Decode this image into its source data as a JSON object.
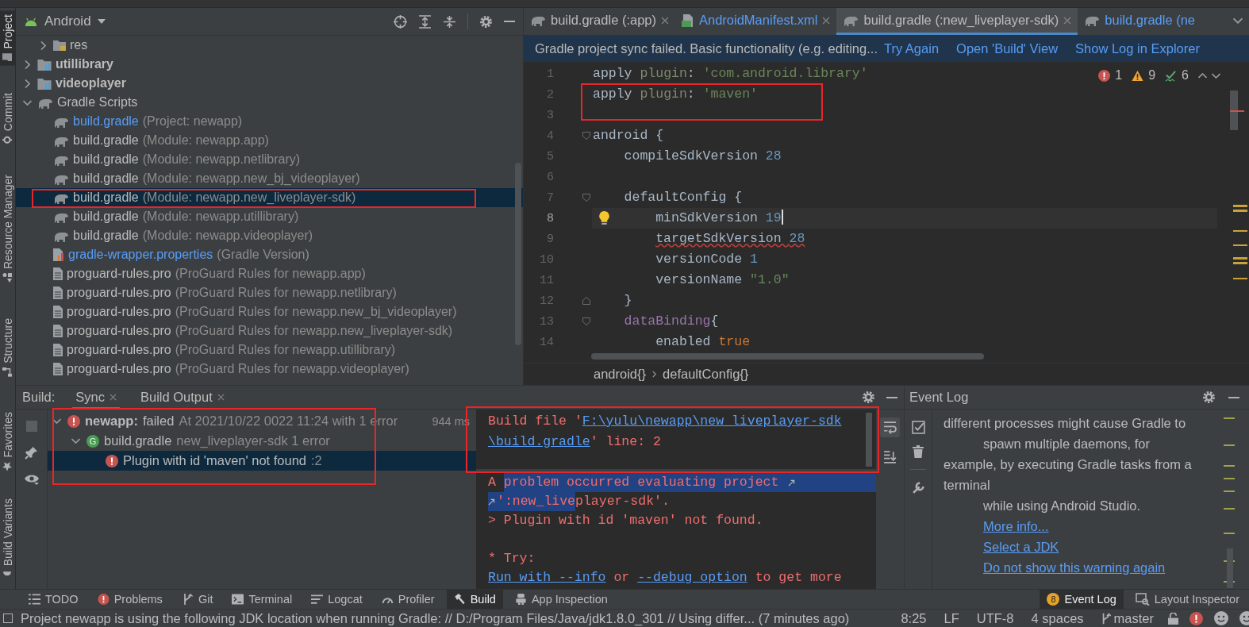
{
  "left_stripe": {
    "top": [
      {
        "label": "Project",
        "selected": true
      },
      {
        "label": "Commit",
        "selected": false
      },
      {
        "label": "Resource Manager",
        "selected": false
      }
    ],
    "middle": [
      {
        "label": "Structure",
        "selected": false
      }
    ],
    "bottom": [
      {
        "label": "Favorites",
        "selected": false
      },
      {
        "label": "Build Variants",
        "selected": false
      }
    ]
  },
  "project": {
    "view": "Android",
    "tree": [
      {
        "label": "res",
        "kind": "res-folder",
        "inside_scrolled_parent": true,
        "expanded": false,
        "selected": false
      },
      {
        "label": "utillibrary",
        "kind": "module",
        "bold": true,
        "expanded": false,
        "selected": false
      },
      {
        "label": "videoplayer",
        "kind": "module",
        "bold": true,
        "expanded": false,
        "selected": false
      },
      {
        "label": "Gradle Scripts",
        "kind": "gradle-folder",
        "expanded": true,
        "selected": false,
        "children": [
          {
            "label": "build.gradle",
            "detail": "(Project: newapp)",
            "kind": "gradle",
            "changed": true,
            "selected": false
          },
          {
            "label": "build.gradle",
            "detail": "(Module: newapp.app)",
            "kind": "gradle",
            "changed": false,
            "selected": false
          },
          {
            "label": "build.gradle",
            "detail": "(Module: newapp.netlibrary)",
            "kind": "gradle",
            "changed": false,
            "selected": false
          },
          {
            "label": "build.gradle",
            "detail": "(Module: newapp.new_bj_videoplayer)",
            "kind": "gradle",
            "changed": false,
            "selected": false
          },
          {
            "label": "build.gradle",
            "detail": "(Module: newapp.new_liveplayer-sdk)",
            "kind": "gradle",
            "changed": false,
            "selected": true
          },
          {
            "label": "build.gradle",
            "detail": "(Module: newapp.utillibrary)",
            "kind": "gradle",
            "changed": false,
            "selected": false
          },
          {
            "label": "build.gradle",
            "detail": "(Module: newapp.videoplayer)",
            "kind": "gradle",
            "changed": false,
            "selected": false
          },
          {
            "label": "gradle-wrapper.properties",
            "detail": "(Gradle Version)",
            "kind": "properties",
            "changed": true,
            "selected": false
          },
          {
            "label": "proguard-rules.pro",
            "detail": "(ProGuard Rules for newapp.app)",
            "kind": "proguard",
            "changed": false,
            "selected": false
          },
          {
            "label": "proguard-rules.pro",
            "detail": "(ProGuard Rules for newapp.netlibrary)",
            "kind": "proguard",
            "changed": false,
            "selected": false
          },
          {
            "label": "proguard-rules.pro",
            "detail": "(ProGuard Rules for newapp.new_bj_videoplayer)",
            "kind": "proguard",
            "changed": false,
            "selected": false
          },
          {
            "label": "proguard-rules.pro",
            "detail": "(ProGuard Rules for newapp.new_liveplayer-sdk)",
            "kind": "proguard",
            "changed": false,
            "selected": false
          },
          {
            "label": "proguard-rules.pro",
            "detail": "(ProGuard Rules for newapp.utillibrary)",
            "kind": "proguard",
            "changed": false,
            "selected": false
          },
          {
            "label": "proguard-rules.pro",
            "detail": "(ProGuard Rules for newapp.videoplayer)",
            "kind": "proguard",
            "changed": false,
            "selected": false
          }
        ]
      }
    ]
  },
  "editor": {
    "tabs": [
      {
        "label": "build.gradle (:app)",
        "kind": "gradle",
        "changed": false,
        "selected": false,
        "closable": true
      },
      {
        "label": "AndroidManifest.xml",
        "kind": "manifest",
        "changed": true,
        "selected": false,
        "closable": true
      },
      {
        "label": "build.gradle (:new_liveplayer-sdk)",
        "kind": "gradle",
        "changed": false,
        "selected": true,
        "closable": true
      },
      {
        "label": "build.gradle (ne",
        "kind": "gradle",
        "changed": true,
        "selected": false,
        "closable": false
      }
    ],
    "banner": {
      "message": "Gradle project sync failed. Basic functionality (e.g. editing...",
      "links": [
        "Try Again",
        "Open 'Build' View",
        "Show Log in Explorer"
      ]
    },
    "inspections": [
      {
        "kind": "error",
        "count": "1"
      },
      {
        "kind": "warning",
        "count": "9"
      },
      {
        "kind": "typo",
        "count": "6"
      }
    ],
    "lines": [
      {
        "number": "1",
        "current": false,
        "tokens": [
          {
            "kind": "plain",
            "text": "apply "
          },
          {
            "kind": "named",
            "text": "plugin"
          },
          {
            "kind": "plain",
            "text": ": "
          },
          {
            "kind": "string",
            "text": "'com.android.library'"
          }
        ]
      },
      {
        "number": "2",
        "current": false,
        "tokens": [
          {
            "kind": "plain",
            "text": "apply "
          },
          {
            "kind": "named",
            "text": "plugin"
          },
          {
            "kind": "plain",
            "text": ": "
          },
          {
            "kind": "string",
            "text": "'maven'"
          }
        ]
      },
      {
        "number": "3",
        "current": false
      },
      {
        "number": "4",
        "current": false,
        "fold_start": true,
        "tokens": [
          {
            "kind": "plain",
            "text": "android {"
          }
        ]
      },
      {
        "number": "5",
        "current": false,
        "tokens": [
          {
            "kind": "plain",
            "text": "    compileSdkVersion "
          },
          {
            "kind": "number",
            "text": "28"
          }
        ]
      },
      {
        "number": "6",
        "current": false
      },
      {
        "number": "7",
        "current": false,
        "fold_start": true,
        "tokens": [
          {
            "kind": "plain",
            "text": "    defaultConfig {"
          }
        ]
      },
      {
        "number": "8",
        "current": true,
        "bulb": true,
        "tokens": [
          {
            "kind": "plain",
            "text": "        minSdkVersion "
          },
          {
            "kind": "number",
            "text": "19"
          }
        ]
      },
      {
        "number": "9",
        "current": false,
        "tokens": [
          {
            "kind": "plain",
            "text": "        targetSdkVersion ",
            "typo": true
          },
          {
            "kind": "number",
            "text": "28",
            "typo": true
          }
        ]
      },
      {
        "number": "10",
        "current": false,
        "tokens": [
          {
            "kind": "plain",
            "text": "        versionCode "
          },
          {
            "kind": "number",
            "text": "1"
          }
        ]
      },
      {
        "number": "11",
        "current": false,
        "tokens": [
          {
            "kind": "plain",
            "text": "        versionName "
          },
          {
            "kind": "string",
            "text": "\"1.0\""
          }
        ]
      },
      {
        "number": "12",
        "current": false,
        "fold_end": true,
        "tokens": [
          {
            "kind": "plain",
            "text": "    }"
          }
        ]
      },
      {
        "number": "13",
        "current": false,
        "fold_start": true,
        "tokens": [
          {
            "kind": "property",
            "text": "    dataBinding"
          },
          {
            "kind": "plain",
            "text": "{"
          }
        ]
      },
      {
        "number": "14",
        "current": false,
        "tokens": [
          {
            "kind": "plain",
            "text": "        enabled "
          },
          {
            "kind": "keyword",
            "text": "true"
          }
        ]
      }
    ],
    "breadcrumbs": [
      "android{}",
      "defaultConfig{}"
    ]
  },
  "build": {
    "title": "Build:",
    "tabs": [
      {
        "label": "Sync",
        "selected": true
      },
      {
        "label": "Build Output",
        "selected": false
      }
    ],
    "tree": [
      {
        "kind": "error",
        "name": "newapp:",
        "name_bold": true,
        "status": "failed",
        "detail": "At 2021/10/22 0022 11:24 with 1 error",
        "time": "944 ms",
        "expanded": true,
        "selected": false,
        "children": [
          {
            "kind": "file",
            "badge": "G",
            "name": "build.gradle",
            "detail": "new_liveplayer-sdk 1 error",
            "expanded": true,
            "selected": false,
            "children": [
              {
                "kind": "error",
                "name": "Plugin with id 'maven' not found",
                "detail": ":2",
                "selected": true
              }
            ]
          }
        ]
      }
    ],
    "file_header": [
      {
        "segments": [
          {
            "text": "Build file '"
          },
          {
            "text": "F:\\yulu\\newapp\\new_liveplayer-sdk",
            "link": true
          }
        ]
      },
      {
        "segments": [
          {
            "text": "\\build.gradle",
            "link": true
          },
          {
            "text": "' line: 2"
          }
        ]
      }
    ],
    "console": [
      {
        "wrapped": true,
        "segments": [
          {
            "text": "A ",
            "selected": false
          },
          {
            "text": "problem occurred evaluating project",
            "selected": true
          }
        ]
      },
      {
        "continued": true,
        "segments": [
          {
            "text": "':new_live",
            "selected": true
          },
          {
            "text": "player-sdk'.",
            "selected": false
          }
        ]
      },
      {
        "segments": [
          {
            "text": "> Plugin with id 'maven' not found."
          }
        ]
      },
      {
        "gap_before": true,
        "segments": [
          {
            "text": "* Try:"
          }
        ]
      },
      {
        "segments": [
          {
            "text": "Run with --info",
            "link": true
          },
          {
            "text": " or "
          },
          {
            "text": "--debug option",
            "link": true
          },
          {
            "text": " to get more"
          }
        ]
      }
    ],
    "soft_wrap": true,
    "scroll_to_end": false
  },
  "event_log": {
    "title": "Event Log",
    "lines": [
      {
        "text": "different processes might cause Gradle to",
        "indent": false,
        "link": false
      },
      {
        "text": "spawn multiple daemons, for",
        "indent": true,
        "link": false
      },
      {
        "text": "example, by executing Gradle tasks from a",
        "indent": false,
        "link": false
      },
      {
        "text": "terminal",
        "indent": false,
        "link": false
      },
      {
        "text": "while using Android Studio.",
        "indent": true,
        "link": false
      },
      {
        "text": "More info...",
        "indent": true,
        "link": true
      },
      {
        "text": "Select a JDK",
        "indent": true,
        "link": true
      },
      {
        "text": "Do not show this warning again",
        "indent": true,
        "link": true
      }
    ]
  },
  "tool_windows": [
    {
      "label": "TODO",
      "selected": false
    },
    {
      "label": "Problems",
      "selected": false
    },
    {
      "label": "Git",
      "selected": false
    },
    {
      "label": "Terminal",
      "selected": false
    },
    {
      "label": "Logcat",
      "selected": false
    },
    {
      "label": "Profiler",
      "selected": false
    },
    {
      "label": "Build",
      "selected": true
    },
    {
      "label": "App Inspection",
      "selected": false
    }
  ],
  "right_tool_windows": [
    {
      "label": "Event Log",
      "badge": "8",
      "selected": true
    },
    {
      "label": "Layout Inspector",
      "selected": false
    }
  ],
  "status_bar": {
    "message": "Project newapp is using the following JDK location when running Gradle: // D:/Program Files/Java/jdk1.8.0_301 // Using differ... (7 minutes ago)",
    "position": "8:25",
    "line_ending": "LF",
    "encoding": "UTF-8",
    "indent": "4 spaces",
    "branch": "master"
  }
}
